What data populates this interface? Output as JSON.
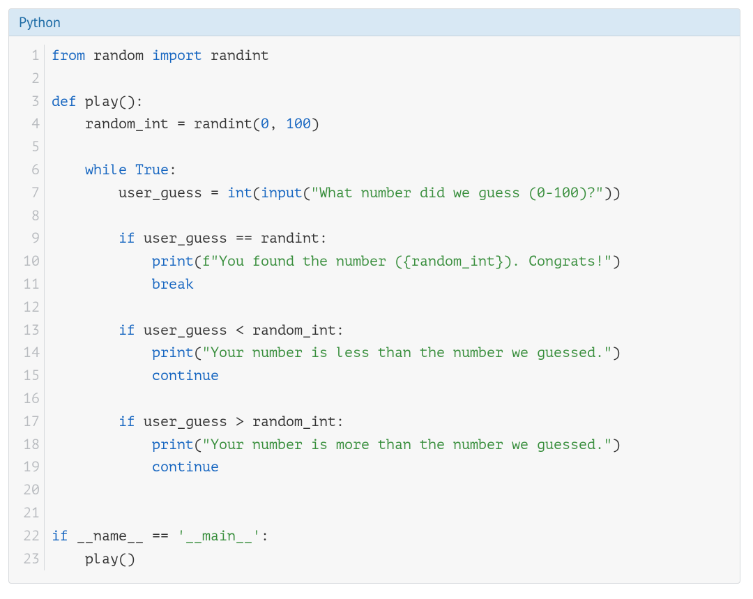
{
  "header": {
    "language_label": "Python"
  },
  "colors": {
    "keyword": "#1565c0",
    "number": "#1565c0",
    "builtin": "#1565c0",
    "string": "#388e3c",
    "plain": "#333333",
    "gutter": "#b8bbbf",
    "bg": "#f7f7f7",
    "header_bg": "#d8e8f4",
    "header_fg": "#1b6aa5"
  },
  "code": {
    "line_count": 23,
    "indent": "    ",
    "lines": [
      {
        "n": 1,
        "tokens": [
          {
            "t": "from",
            "c": "keyword"
          },
          {
            "t": " ",
            "c": "plain"
          },
          {
            "t": "random",
            "c": "plain"
          },
          {
            "t": " ",
            "c": "plain"
          },
          {
            "t": "import",
            "c": "keyword"
          },
          {
            "t": " ",
            "c": "plain"
          },
          {
            "t": "randint",
            "c": "plain"
          }
        ]
      },
      {
        "n": 2,
        "tokens": []
      },
      {
        "n": 3,
        "tokens": [
          {
            "t": "def",
            "c": "keyword"
          },
          {
            "t": " ",
            "c": "plain"
          },
          {
            "t": "play",
            "c": "funcname"
          },
          {
            "t": "():",
            "c": "punct"
          }
        ]
      },
      {
        "n": 4,
        "tokens": [
          {
            "t": "    ",
            "c": "plain"
          },
          {
            "t": "random_int ",
            "c": "plain"
          },
          {
            "t": "=",
            "c": "punct"
          },
          {
            "t": " randint(",
            "c": "plain"
          },
          {
            "t": "0",
            "c": "number"
          },
          {
            "t": ", ",
            "c": "plain"
          },
          {
            "t": "100",
            "c": "number"
          },
          {
            "t": ")",
            "c": "plain"
          }
        ]
      },
      {
        "n": 5,
        "tokens": []
      },
      {
        "n": 6,
        "tokens": [
          {
            "t": "    ",
            "c": "plain"
          },
          {
            "t": "while",
            "c": "keyword"
          },
          {
            "t": " ",
            "c": "plain"
          },
          {
            "t": "True",
            "c": "const"
          },
          {
            "t": ":",
            "c": "punct"
          }
        ]
      },
      {
        "n": 7,
        "tokens": [
          {
            "t": "        ",
            "c": "plain"
          },
          {
            "t": "user_guess ",
            "c": "plain"
          },
          {
            "t": "=",
            "c": "punct"
          },
          {
            "t": " ",
            "c": "plain"
          },
          {
            "t": "int",
            "c": "builtin"
          },
          {
            "t": "(",
            "c": "plain"
          },
          {
            "t": "input",
            "c": "builtin"
          },
          {
            "t": "(",
            "c": "plain"
          },
          {
            "t": "\"What number did we guess (0-100)?\"",
            "c": "string"
          },
          {
            "t": "))",
            "c": "plain"
          }
        ]
      },
      {
        "n": 8,
        "tokens": []
      },
      {
        "n": 9,
        "tokens": [
          {
            "t": "        ",
            "c": "plain"
          },
          {
            "t": "if",
            "c": "keyword"
          },
          {
            "t": " user_guess ",
            "c": "plain"
          },
          {
            "t": "==",
            "c": "punct"
          },
          {
            "t": " randint:",
            "c": "plain"
          }
        ]
      },
      {
        "n": 10,
        "tokens": [
          {
            "t": "            ",
            "c": "plain"
          },
          {
            "t": "print",
            "c": "builtin"
          },
          {
            "t": "(",
            "c": "plain"
          },
          {
            "t": "f\"You found the number (",
            "c": "string"
          },
          {
            "t": "{random_int}",
            "c": "string"
          },
          {
            "t": "). Congrats!\"",
            "c": "string"
          },
          {
            "t": ")",
            "c": "plain"
          }
        ]
      },
      {
        "n": 11,
        "tokens": [
          {
            "t": "            ",
            "c": "plain"
          },
          {
            "t": "break",
            "c": "keyword"
          }
        ]
      },
      {
        "n": 12,
        "tokens": []
      },
      {
        "n": 13,
        "tokens": [
          {
            "t": "        ",
            "c": "plain"
          },
          {
            "t": "if",
            "c": "keyword"
          },
          {
            "t": " user_guess ",
            "c": "plain"
          },
          {
            "t": "<",
            "c": "punct"
          },
          {
            "t": " random_int:",
            "c": "plain"
          }
        ]
      },
      {
        "n": 14,
        "tokens": [
          {
            "t": "            ",
            "c": "plain"
          },
          {
            "t": "print",
            "c": "builtin"
          },
          {
            "t": "(",
            "c": "plain"
          },
          {
            "t": "\"Your number is less than the number we guessed.\"",
            "c": "string"
          },
          {
            "t": ")",
            "c": "plain"
          }
        ]
      },
      {
        "n": 15,
        "tokens": [
          {
            "t": "            ",
            "c": "plain"
          },
          {
            "t": "continue",
            "c": "keyword"
          }
        ]
      },
      {
        "n": 16,
        "tokens": []
      },
      {
        "n": 17,
        "tokens": [
          {
            "t": "        ",
            "c": "plain"
          },
          {
            "t": "if",
            "c": "keyword"
          },
          {
            "t": " user_guess ",
            "c": "plain"
          },
          {
            "t": ">",
            "c": "punct"
          },
          {
            "t": " random_int:",
            "c": "plain"
          }
        ]
      },
      {
        "n": 18,
        "tokens": [
          {
            "t": "            ",
            "c": "plain"
          },
          {
            "t": "print",
            "c": "builtin"
          },
          {
            "t": "(",
            "c": "plain"
          },
          {
            "t": "\"Your number is more than the number we guessed.\"",
            "c": "string"
          },
          {
            "t": ")",
            "c": "plain"
          }
        ]
      },
      {
        "n": 19,
        "tokens": [
          {
            "t": "            ",
            "c": "plain"
          },
          {
            "t": "continue",
            "c": "keyword"
          }
        ]
      },
      {
        "n": 20,
        "tokens": []
      },
      {
        "n": 21,
        "tokens": []
      },
      {
        "n": 22,
        "tokens": [
          {
            "t": "if",
            "c": "keyword"
          },
          {
            "t": " __name__ ",
            "c": "plain"
          },
          {
            "t": "==",
            "c": "punct"
          },
          {
            "t": " ",
            "c": "plain"
          },
          {
            "t": "'__main__'",
            "c": "string"
          },
          {
            "t": ":",
            "c": "punct"
          }
        ]
      },
      {
        "n": 23,
        "tokens": [
          {
            "t": "    ",
            "c": "plain"
          },
          {
            "t": "play()",
            "c": "plain"
          }
        ]
      }
    ]
  }
}
